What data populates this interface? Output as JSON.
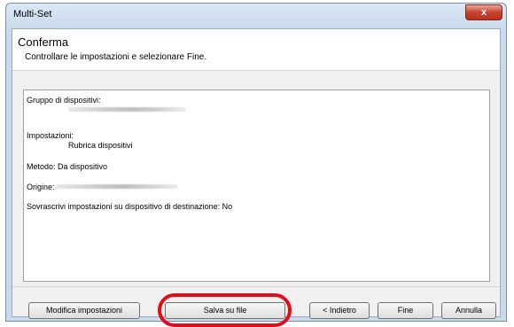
{
  "window": {
    "title": "Multi-Set",
    "close_label": "x"
  },
  "header": {
    "title": "Conferma",
    "subtitle": "Controllare le impostazioni e selezionare Fine."
  },
  "summary": {
    "group_label": "Gruppo di dispositivi:",
    "settings_label": "Impostazioni:",
    "settings_value": "Rubrica dispositivi",
    "method_label": "Metodo: Da dispositivo",
    "origin_label": "Origine:",
    "overwrite_label": "Sovrascrivi impostazioni su dispositivo di destinazione: No"
  },
  "buttons": {
    "modify": "Modifica impostazioni",
    "save_file": "Salva su file",
    "back": "< Indietro",
    "finish": "Fine",
    "cancel": "Annulla"
  },
  "colors": {
    "highlight": "#e10b19"
  }
}
